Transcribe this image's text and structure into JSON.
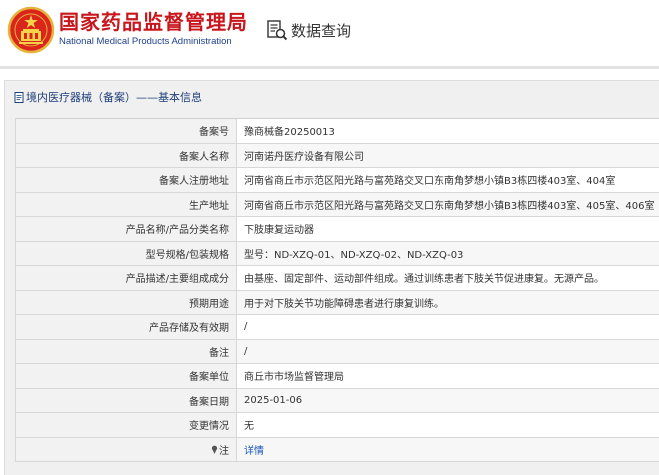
{
  "header": {
    "logo_cn": "国家药品监督管理局",
    "logo_en": "National Medical Products Administration",
    "query_label": "数据查询"
  },
  "panel": {
    "title": "境内医疗器械（备案）——基本信息"
  },
  "fields": [
    {
      "label": "备案号",
      "value": "豫商械备20250013"
    },
    {
      "label": "备案人名称",
      "value": "河南诺丹医疗设备有限公司"
    },
    {
      "label": "备案人注册地址",
      "value": "河南省商丘市示范区阳光路与富苑路交叉口东南角梦想小镇B3栋四楼403室、404室"
    },
    {
      "label": "生产地址",
      "value": "河南省商丘市示范区阳光路与富苑路交叉口东南角梦想小镇B3栋四楼403室、405室、406室"
    },
    {
      "label": "产品名称/产品分类名称",
      "value": "下肢康复运动器"
    },
    {
      "label": "型号规格/包装规格",
      "value": "型号：ND-XZQ-01、ND-XZQ-02、ND-XZQ-03"
    },
    {
      "label": "产品描述/主要组成成分",
      "value": "由基座、固定部件、运动部件组成。通过训练患者下肢关节促进康复。无源产品。"
    },
    {
      "label": "预期用途",
      "value": "用于对下肢关节功能障碍患者进行康复训练。"
    },
    {
      "label": "产品存储及有效期",
      "value": "/"
    },
    {
      "label": "备注",
      "value": "/"
    },
    {
      "label": "备案单位",
      "value": "商丘市市场监督管理局"
    },
    {
      "label": "备案日期",
      "value": "2025-01-06"
    },
    {
      "label": "变更情况",
      "value": "无"
    },
    {
      "label": "注",
      "value": "详情"
    }
  ],
  "colors": {
    "brand_red": "#c8161d",
    "brand_blue": "#1e3f8a",
    "link_blue": "#1a55b8"
  }
}
